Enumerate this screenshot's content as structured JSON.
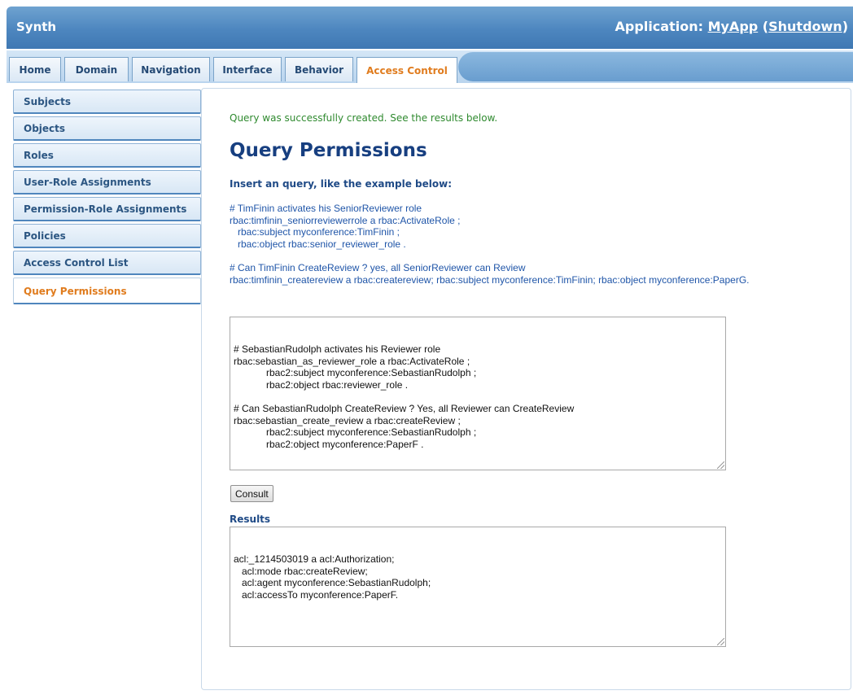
{
  "header": {
    "brand": "Synth",
    "app_prefix": "Application: ",
    "app_name": "MyApp",
    "paren_open": " (",
    "shutdown_label": "Shutdown",
    "paren_close": ")"
  },
  "tabs": [
    {
      "label": "Home"
    },
    {
      "label": "Domain"
    },
    {
      "label": "Navigation"
    },
    {
      "label": "Interface"
    },
    {
      "label": "Behavior"
    },
    {
      "label": "Access Control"
    }
  ],
  "active_tab": "Access Control",
  "sidebar": {
    "items": [
      {
        "label": "Subjects"
      },
      {
        "label": "Objects"
      },
      {
        "label": "Roles"
      },
      {
        "label": "User-Role Assignments"
      },
      {
        "label": "Permission-Role Assignments"
      },
      {
        "label": "Policies"
      },
      {
        "label": "Access Control List"
      },
      {
        "label": "Query Permissions"
      }
    ],
    "active": "Query Permissions"
  },
  "main": {
    "success_message": "Query was successfully created. See the results below.",
    "title": "Query Permissions",
    "instruction": "Insert an query, like the example below:",
    "example": "# TimFinin activates his SeniorReviewer role\nrbac:timfinin_seniorreviewerrole a rbac:ActivateRole ;\n   rbac:subject myconference:TimFinin ;\n   rbac:object rbac:senior_reviewer_role .\n\n# Can TimFinin CreateReview ? yes, all SeniorReviewer can Review\nrbac:timfinin_createreview a rbac:createreview; rbac:subject myconference:TimFinin; rbac:object myconference:PaperG.",
    "query_value": "# SebastianRudolph activates his Reviewer role\nrbac:sebastian_as_reviewer_role a rbac:ActivateRole ;\n\t    rbac2:subject myconference:SebastianRudolph ;\n\t    rbac2:object rbac:reviewer_role .\n\n# Can SebastianRudolph CreateReview ? Yes, all Reviewer can CreateReview\nrbac:sebastian_create_review a rbac:createReview ;\n\t    rbac2:subject myconference:SebastianRudolph ;\n\t    rbac2:object myconference:PaperF .",
    "consult_label": "Consult",
    "results_label": "Results",
    "results_value": "acl:_1214503019 a acl:Authorization;\n   acl:mode rbac:createReview;\n   acl:agent myconference:SebastianRudolph;\n   acl:accessTo myconference:PaperF."
  },
  "colors": {
    "brand_blue": "#4d86bf",
    "active_orange": "#e07c1e",
    "title_blue": "#173f80",
    "success_green": "#2f8a2f",
    "example_blue": "#1f55a8"
  }
}
